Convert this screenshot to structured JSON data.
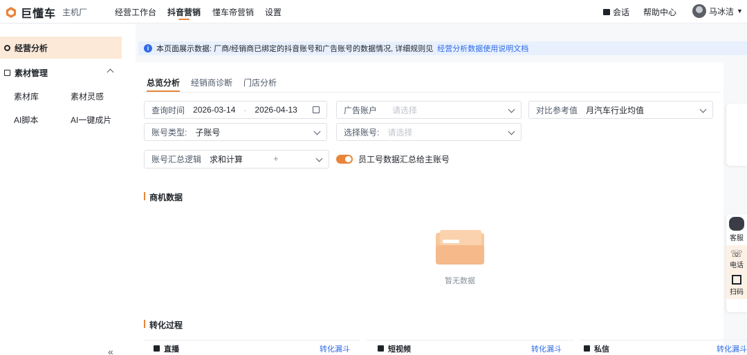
{
  "header": {
    "brand": "巨懂车",
    "brand_sub": "主机厂",
    "nav": [
      "经营工作台",
      "抖音营销",
      "懂车帝营销",
      "设置"
    ],
    "active_nav": "抖音营销",
    "session": "会话",
    "help": "帮助中心",
    "user_name": "马冰洁"
  },
  "sidebar": {
    "active_item": "经营分析",
    "group_label": "素材管理",
    "sub_items": [
      "素材库",
      "素材灵感",
      "AI脚本",
      "AI一键成片"
    ],
    "collapse_label": "«"
  },
  "banner": {
    "text": "本页面展示数据: 厂商/经销商已绑定的抖音账号和广告账号的数据情况, 详细规则见",
    "link": "经营分析数据使用说明文档"
  },
  "tabs": [
    "总览分析",
    "经销商诊断",
    "门店分析"
  ],
  "filters": {
    "query_time_label": "查询时间",
    "date_start": "2026-03-14",
    "date_sep": "-",
    "date_end": "2026-04-13",
    "ad_account_label": "广告账户",
    "ad_account_placeholder": "请选择",
    "compare_label": "对比参考值",
    "compare_value": "月汽车行业均值",
    "account_type_label": "账号类型:",
    "account_type_value": "子账号",
    "select_account_label": "选择账号:",
    "select_account_placeholder": "请选择",
    "summary_logic_label": "账号汇总逻辑",
    "summary_logic_value": "求和计算",
    "toggle_label": "员工号数据汇总给主账号",
    "toggle_on": true
  },
  "sections": {
    "business_data": "商机数据",
    "empty_text": "暂无数据",
    "conversion": "转化过程"
  },
  "conversion_cards": [
    {
      "name": "直播",
      "link": "转化漏斗"
    },
    {
      "name": "短视频",
      "link": "转化漏斗"
    },
    {
      "name": "私信",
      "link": "转化漏斗"
    }
  ],
  "float_panel": {
    "items": [
      "客服",
      "电话",
      "扫码"
    ]
  },
  "colors": {
    "accent": "#e8853a",
    "link": "#2e6be6",
    "active_bg": "#fde9d8"
  }
}
